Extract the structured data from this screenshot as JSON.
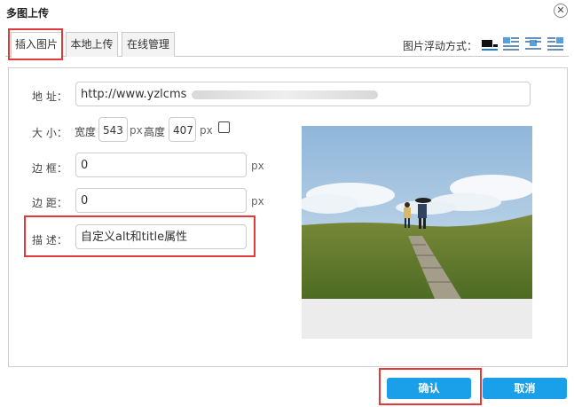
{
  "dialog": {
    "title": "多图上传",
    "close_symbol": "✕"
  },
  "tabs": [
    {
      "label": "插入图片",
      "active": true
    },
    {
      "label": "本地上传",
      "active": false
    },
    {
      "label": "在线管理",
      "active": false
    }
  ],
  "float": {
    "label": "图片浮动方式：",
    "options": [
      "float-none-icon",
      "float-left-icon",
      "float-center-icon",
      "float-right-icon"
    ],
    "selected": "float-none-icon"
  },
  "form": {
    "address": {
      "label": "地 址：",
      "value": "http://www.yzlcms"
    },
    "size": {
      "label": "大 小：",
      "width_label": "宽度",
      "width_value": "543",
      "height_label": "高度",
      "height_value": "407",
      "unit": "px",
      "lock_ratio_checked": false
    },
    "border": {
      "label": "边 框：",
      "value": "0",
      "unit": "px"
    },
    "margin": {
      "label": "边 距：",
      "value": "0",
      "unit": "px"
    },
    "description": {
      "label": "描 述：",
      "value": "自定义alt和title属性"
    }
  },
  "buttons": {
    "confirm": "确认",
    "cancel": "取消"
  },
  "colors": {
    "accent": "#1aa0e8",
    "highlight": "#e23a3a"
  }
}
